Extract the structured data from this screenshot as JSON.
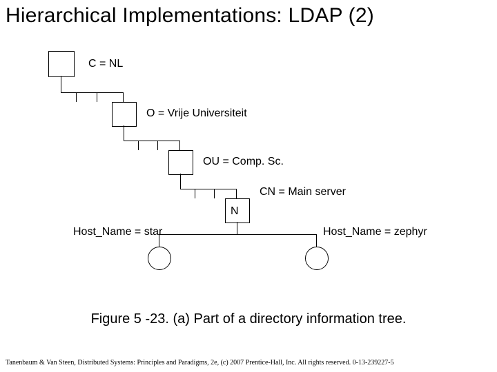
{
  "title": "Hierarchical Implementations: LDAP (2)",
  "tree": {
    "c_label": "C = NL",
    "o_label": "O = Vrije Universiteit",
    "ou_label": "OU = Comp. Sc.",
    "cn_label": "CN = Main server",
    "n_text": "N",
    "host_left": "Host_Name = star",
    "host_right": "Host_Name = zephyr"
  },
  "caption": "Figure 5 -23. (a) Part of a directory information tree.",
  "footer": "Tanenbaum & Van Steen, Distributed Systems: Principles and Paradigms, 2e, (c) 2007 Prentice-Hall, Inc. All rights reserved. 0-13-239227-5"
}
